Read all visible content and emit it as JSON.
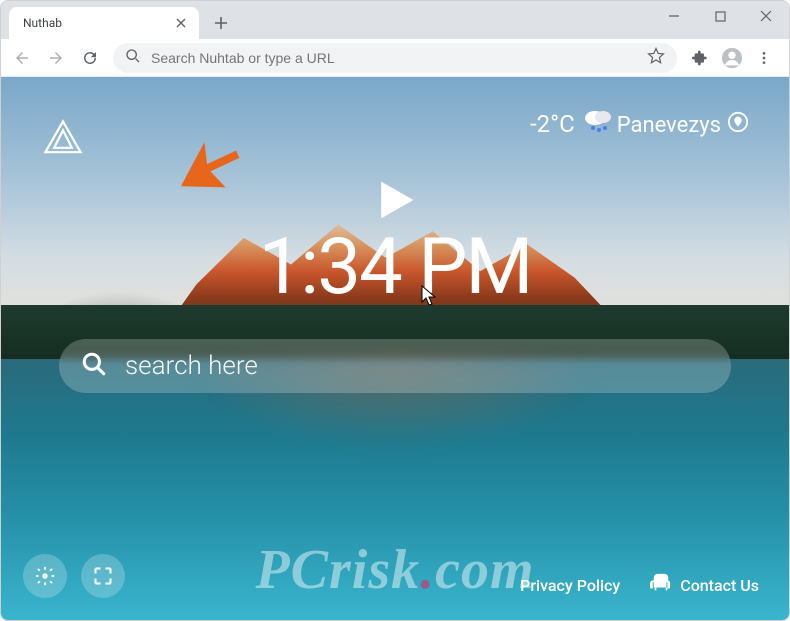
{
  "tab": {
    "title": "Nuthab"
  },
  "address": {
    "placeholder": "Search Nuhtab or type a URL"
  },
  "weather": {
    "temperature": "-2°C",
    "location": "Panevezys"
  },
  "clock": {
    "time": "1:34 PM"
  },
  "search": {
    "placeholder": "search here"
  },
  "footer": {
    "privacy": "Privacy Policy",
    "contact": "Contact Us"
  },
  "watermark": {
    "text_prefix": "PCrisk",
    "text_suffix": "com"
  }
}
